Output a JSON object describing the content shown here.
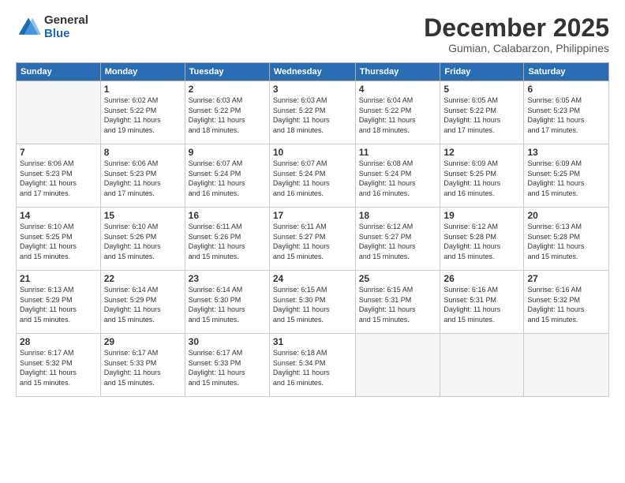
{
  "header": {
    "logo_general": "General",
    "logo_blue": "Blue",
    "month_title": "December 2025",
    "location": "Gumian, Calabarzon, Philippines"
  },
  "weekdays": [
    "Sunday",
    "Monday",
    "Tuesday",
    "Wednesday",
    "Thursday",
    "Friday",
    "Saturday"
  ],
  "weeks": [
    [
      {
        "day": "",
        "info": ""
      },
      {
        "day": "1",
        "info": "Sunrise: 6:02 AM\nSunset: 5:22 PM\nDaylight: 11 hours\nand 19 minutes."
      },
      {
        "day": "2",
        "info": "Sunrise: 6:03 AM\nSunset: 5:22 PM\nDaylight: 11 hours\nand 18 minutes."
      },
      {
        "day": "3",
        "info": "Sunrise: 6:03 AM\nSunset: 5:22 PM\nDaylight: 11 hours\nand 18 minutes."
      },
      {
        "day": "4",
        "info": "Sunrise: 6:04 AM\nSunset: 5:22 PM\nDaylight: 11 hours\nand 18 minutes."
      },
      {
        "day": "5",
        "info": "Sunrise: 6:05 AM\nSunset: 5:22 PM\nDaylight: 11 hours\nand 17 minutes."
      },
      {
        "day": "6",
        "info": "Sunrise: 6:05 AM\nSunset: 5:23 PM\nDaylight: 11 hours\nand 17 minutes."
      }
    ],
    [
      {
        "day": "7",
        "info": "Sunrise: 6:06 AM\nSunset: 5:23 PM\nDaylight: 11 hours\nand 17 minutes."
      },
      {
        "day": "8",
        "info": "Sunrise: 6:06 AM\nSunset: 5:23 PM\nDaylight: 11 hours\nand 17 minutes."
      },
      {
        "day": "9",
        "info": "Sunrise: 6:07 AM\nSunset: 5:24 PM\nDaylight: 11 hours\nand 16 minutes."
      },
      {
        "day": "10",
        "info": "Sunrise: 6:07 AM\nSunset: 5:24 PM\nDaylight: 11 hours\nand 16 minutes."
      },
      {
        "day": "11",
        "info": "Sunrise: 6:08 AM\nSunset: 5:24 PM\nDaylight: 11 hours\nand 16 minutes."
      },
      {
        "day": "12",
        "info": "Sunrise: 6:09 AM\nSunset: 5:25 PM\nDaylight: 11 hours\nand 16 minutes."
      },
      {
        "day": "13",
        "info": "Sunrise: 6:09 AM\nSunset: 5:25 PM\nDaylight: 11 hours\nand 15 minutes."
      }
    ],
    [
      {
        "day": "14",
        "info": "Sunrise: 6:10 AM\nSunset: 5:25 PM\nDaylight: 11 hours\nand 15 minutes."
      },
      {
        "day": "15",
        "info": "Sunrise: 6:10 AM\nSunset: 5:26 PM\nDaylight: 11 hours\nand 15 minutes."
      },
      {
        "day": "16",
        "info": "Sunrise: 6:11 AM\nSunset: 5:26 PM\nDaylight: 11 hours\nand 15 minutes."
      },
      {
        "day": "17",
        "info": "Sunrise: 6:11 AM\nSunset: 5:27 PM\nDaylight: 11 hours\nand 15 minutes."
      },
      {
        "day": "18",
        "info": "Sunrise: 6:12 AM\nSunset: 5:27 PM\nDaylight: 11 hours\nand 15 minutes."
      },
      {
        "day": "19",
        "info": "Sunrise: 6:12 AM\nSunset: 5:28 PM\nDaylight: 11 hours\nand 15 minutes."
      },
      {
        "day": "20",
        "info": "Sunrise: 6:13 AM\nSunset: 5:28 PM\nDaylight: 11 hours\nand 15 minutes."
      }
    ],
    [
      {
        "day": "21",
        "info": "Sunrise: 6:13 AM\nSunset: 5:29 PM\nDaylight: 11 hours\nand 15 minutes."
      },
      {
        "day": "22",
        "info": "Sunrise: 6:14 AM\nSunset: 5:29 PM\nDaylight: 11 hours\nand 15 minutes."
      },
      {
        "day": "23",
        "info": "Sunrise: 6:14 AM\nSunset: 5:30 PM\nDaylight: 11 hours\nand 15 minutes."
      },
      {
        "day": "24",
        "info": "Sunrise: 6:15 AM\nSunset: 5:30 PM\nDaylight: 11 hours\nand 15 minutes."
      },
      {
        "day": "25",
        "info": "Sunrise: 6:15 AM\nSunset: 5:31 PM\nDaylight: 11 hours\nand 15 minutes."
      },
      {
        "day": "26",
        "info": "Sunrise: 6:16 AM\nSunset: 5:31 PM\nDaylight: 11 hours\nand 15 minutes."
      },
      {
        "day": "27",
        "info": "Sunrise: 6:16 AM\nSunset: 5:32 PM\nDaylight: 11 hours\nand 15 minutes."
      }
    ],
    [
      {
        "day": "28",
        "info": "Sunrise: 6:17 AM\nSunset: 5:32 PM\nDaylight: 11 hours\nand 15 minutes."
      },
      {
        "day": "29",
        "info": "Sunrise: 6:17 AM\nSunset: 5:33 PM\nDaylight: 11 hours\nand 15 minutes."
      },
      {
        "day": "30",
        "info": "Sunrise: 6:17 AM\nSunset: 5:33 PM\nDaylight: 11 hours\nand 15 minutes."
      },
      {
        "day": "31",
        "info": "Sunrise: 6:18 AM\nSunset: 5:34 PM\nDaylight: 11 hours\nand 16 minutes."
      },
      {
        "day": "",
        "info": ""
      },
      {
        "day": "",
        "info": ""
      },
      {
        "day": "",
        "info": ""
      }
    ]
  ]
}
